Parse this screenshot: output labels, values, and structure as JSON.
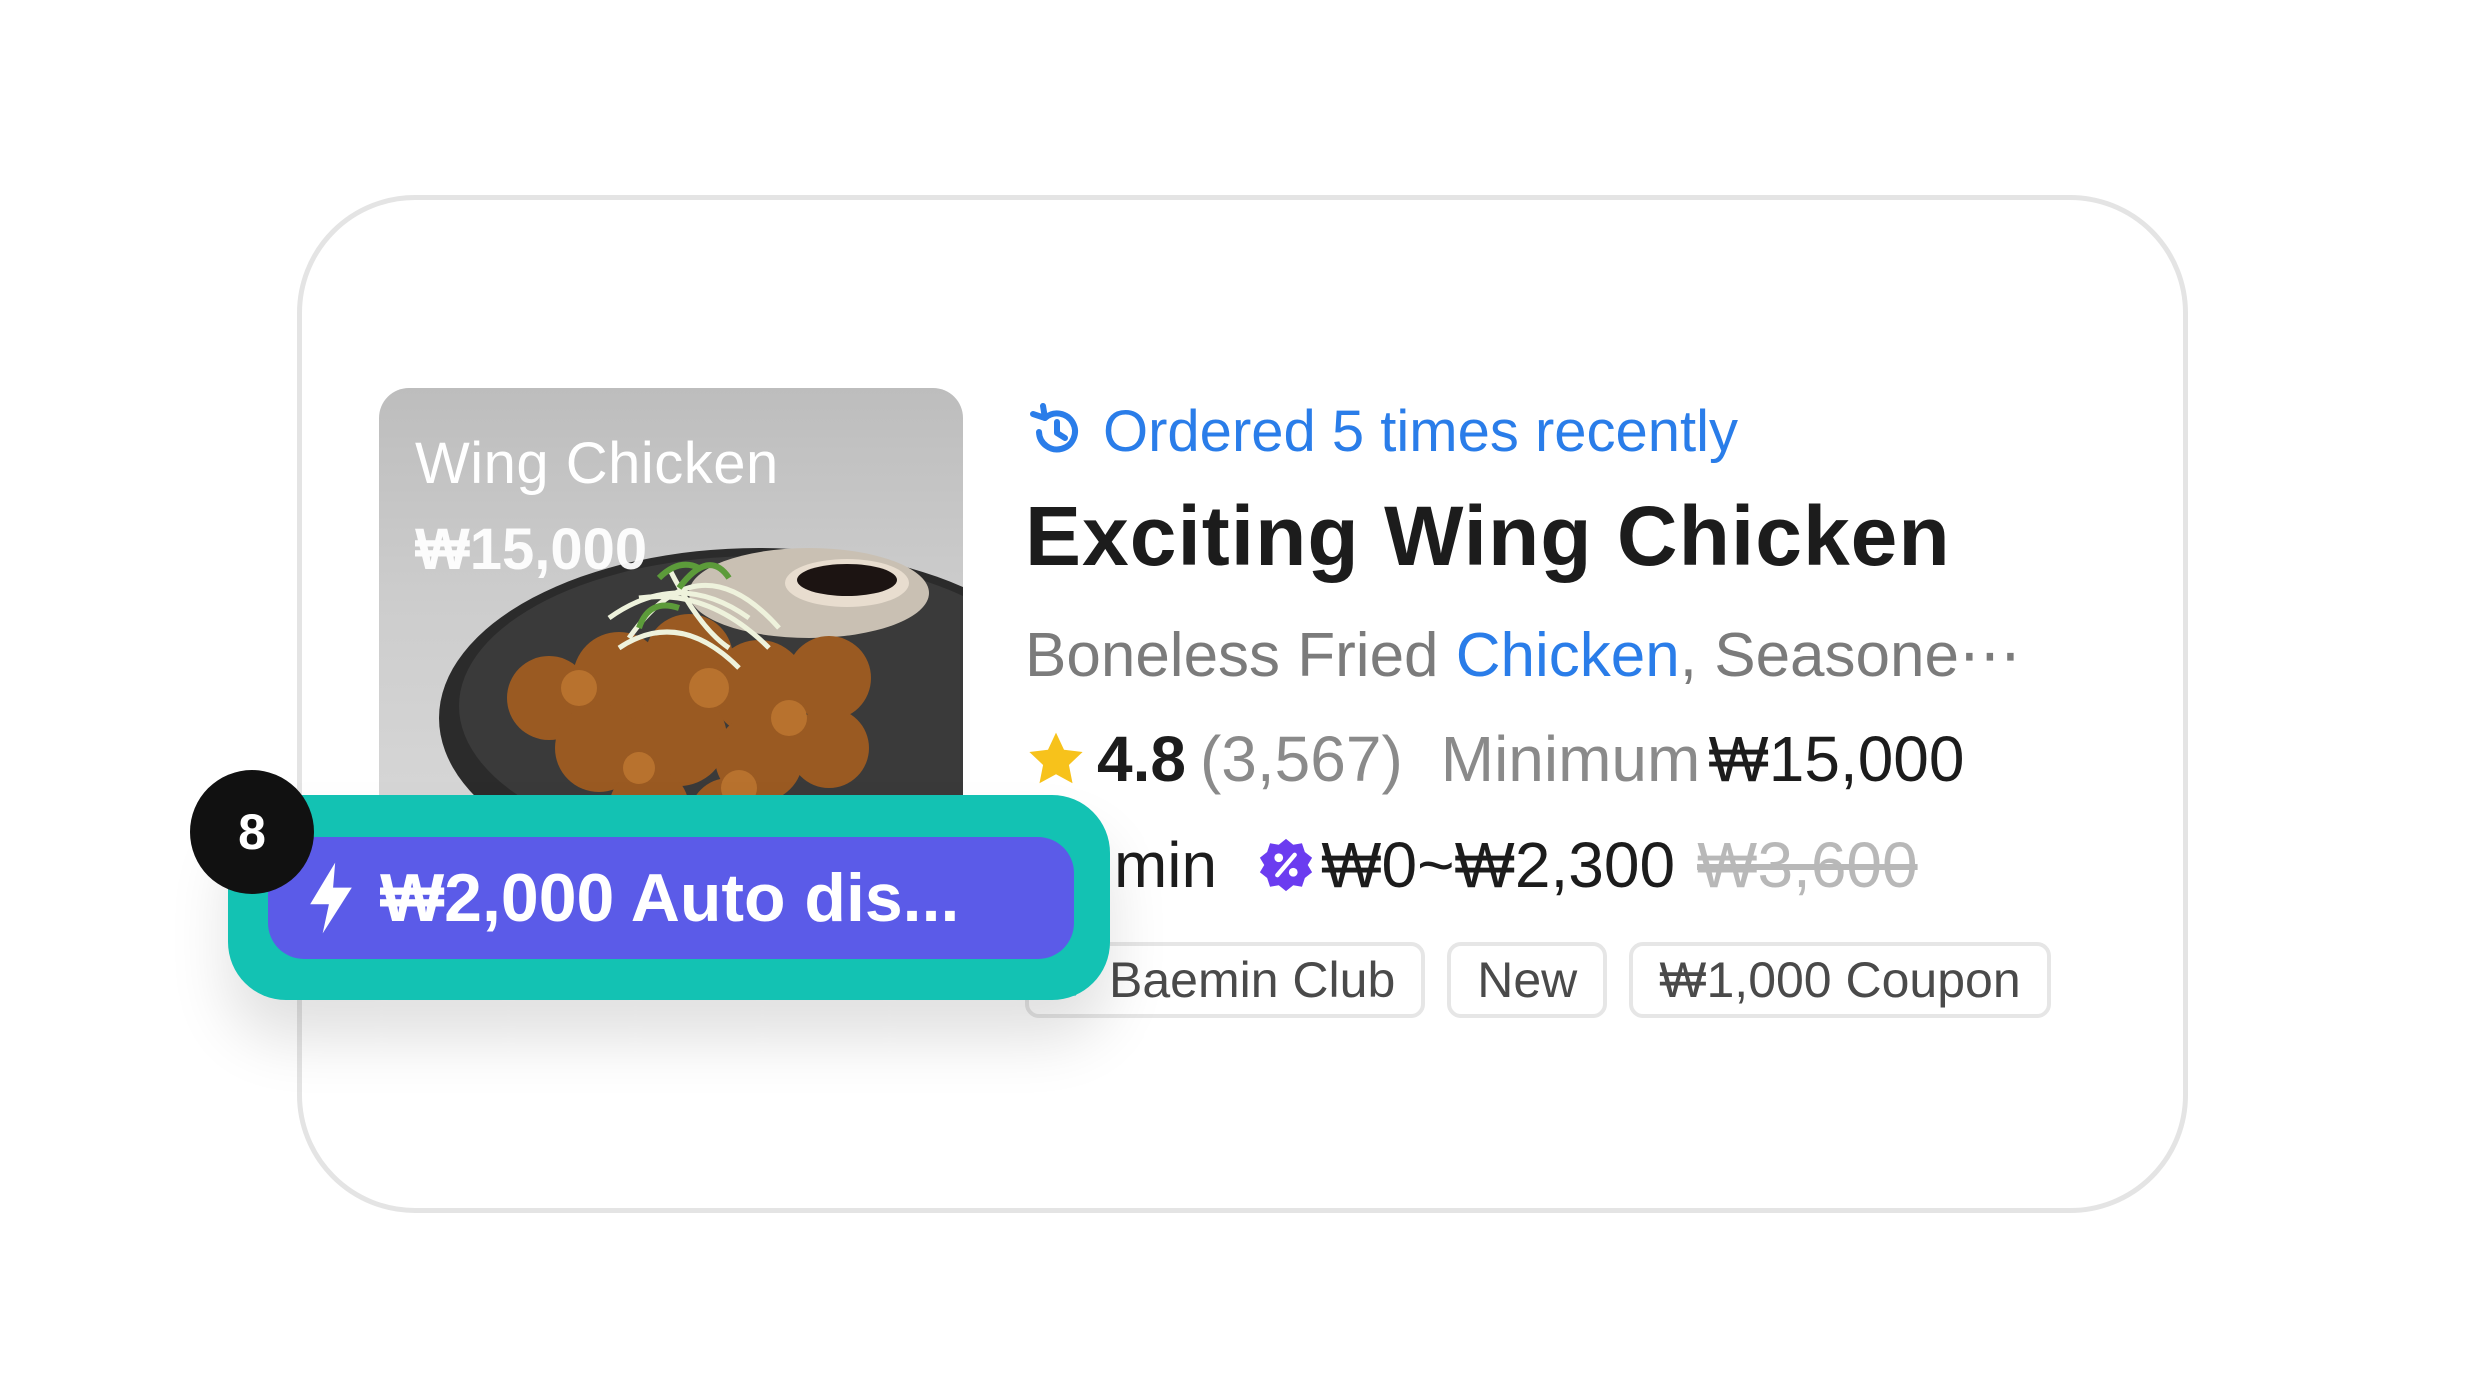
{
  "thumbnail": {
    "name": "Wing Chicken",
    "price": "₩15,000"
  },
  "store": {
    "recent_orders": "Ordered 5 times recently",
    "title": "Exciting Wing Chicken",
    "menu_prefix": "Boneless Fried ",
    "menu_highlight": "Chicken",
    "menu_suffix": ", Seasone⋯",
    "rating": "4.8",
    "review_count": "(3,567)",
    "minimum_label": "Minimum",
    "minimum_value": "₩15,000",
    "delivery_time": "30 min",
    "delivery_fee": "₩0~₩2,300",
    "original_fee": "₩3,600"
  },
  "tags": [
    {
      "label": "Baemin Club",
      "icon": "club-icon"
    },
    {
      "label": "New"
    },
    {
      "label": "₩1,000 Coupon"
    }
  ],
  "promo": {
    "label": "₩2,000 Auto dis...",
    "icon": "lightning-icon"
  },
  "step_badge": "8",
  "colors": {
    "accent_blue": "#2a7de9",
    "promo_teal": "#13c2b3",
    "promo_purple": "#5b5be8",
    "star_yellow": "#f7c21b",
    "discount_purple": "#6b3cf0"
  }
}
